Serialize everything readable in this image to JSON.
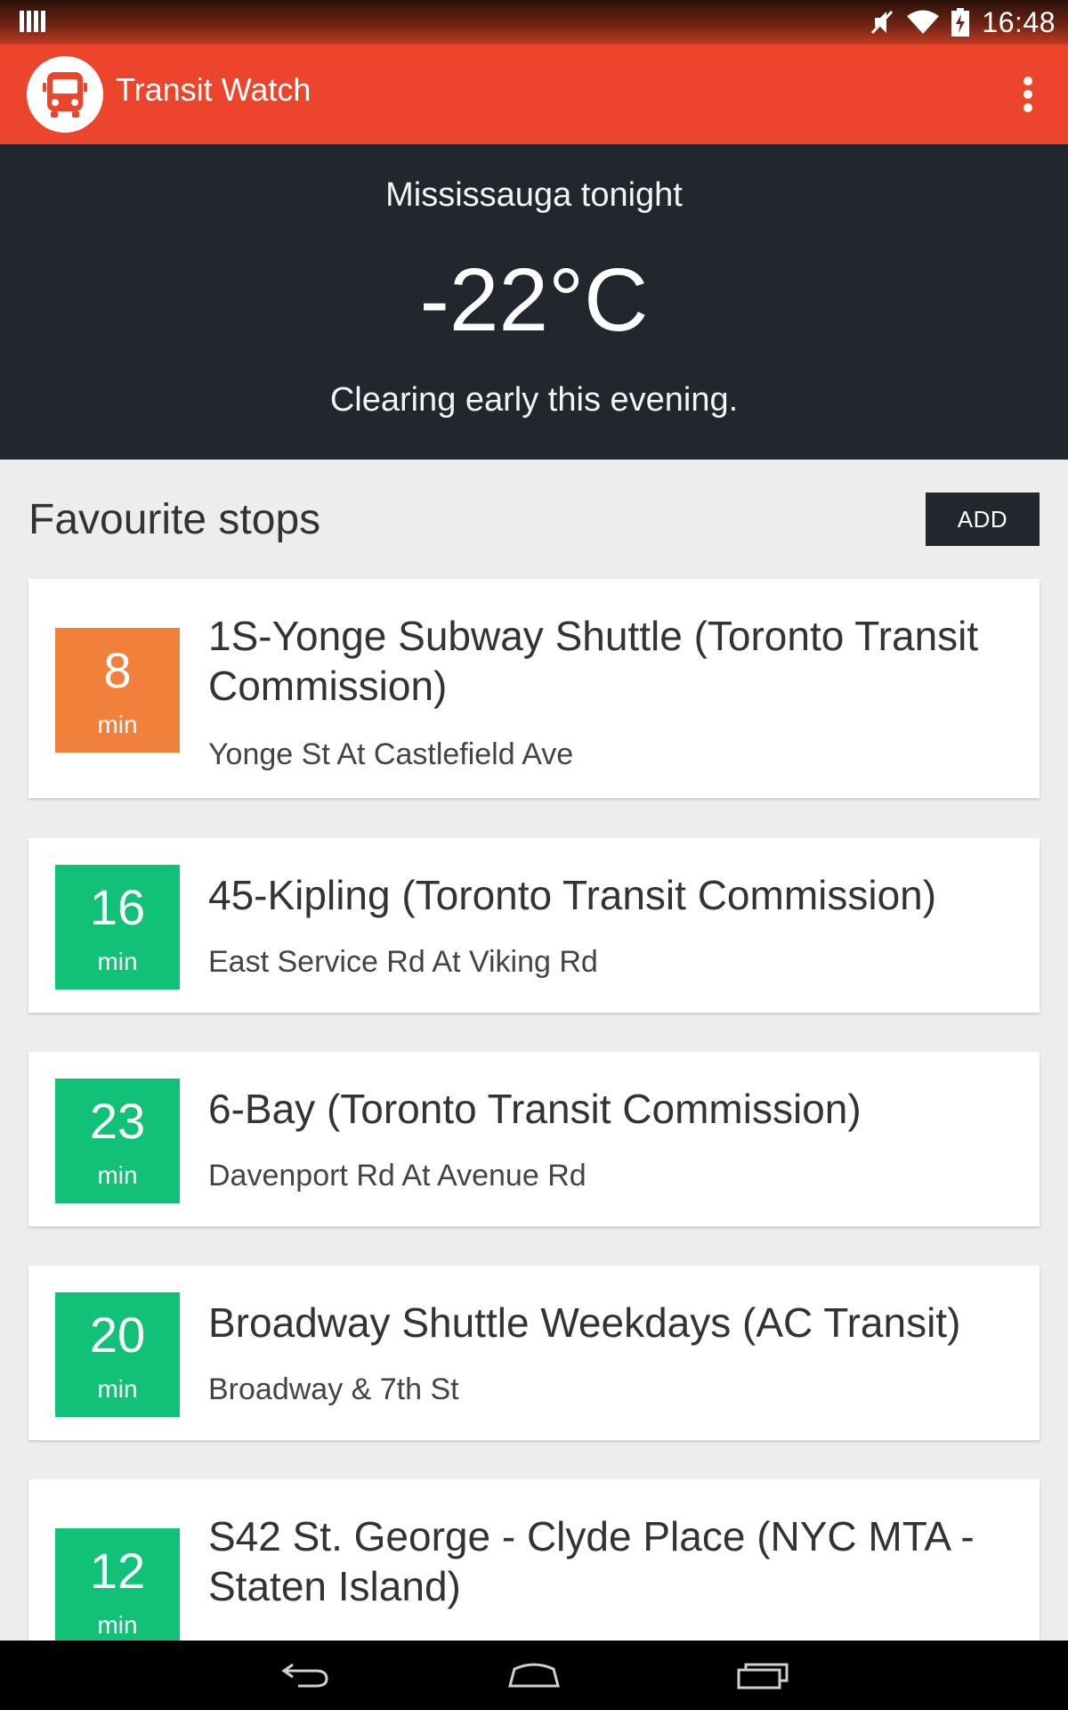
{
  "status_bar": {
    "time": "16:48",
    "icons": [
      "barcode-icon",
      "mute-icon",
      "wifi-icon",
      "battery-charging-icon"
    ]
  },
  "app_bar": {
    "title": "Transit Watch",
    "logo_icon": "bus-icon",
    "menu_icon": "more-vert-icon",
    "color": "#ec452c"
  },
  "weather": {
    "location": "Mississauga tonight",
    "temperature": "-22°C",
    "description": "Clearing early this evening."
  },
  "favourites": {
    "title": "Favourite stops",
    "add_label": "ADD",
    "stops": [
      {
        "eta": "8",
        "unit": "min",
        "route": "1S-Yonge Subway Shuttle (Toronto Transit Commission)",
        "stop": "Yonge St At Castlefield Ave",
        "color": "#f1803b"
      },
      {
        "eta": "16",
        "unit": "min",
        "route": "45-Kipling (Toronto Transit Commission)",
        "stop": "East Service Rd At Viking Rd",
        "color": "#12c178"
      },
      {
        "eta": "23",
        "unit": "min",
        "route": "6-Bay (Toronto Transit Commission)",
        "stop": "Davenport Rd At Avenue Rd",
        "color": "#12c178"
      },
      {
        "eta": "20",
        "unit": "min",
        "route": "Broadway Shuttle Weekdays (AC Transit)",
        "stop": "Broadway & 7th St",
        "color": "#12c178"
      },
      {
        "eta": "12",
        "unit": "min",
        "route": "S42 St. George - Clyde Place (NYC MTA - Staten Island)",
        "stop": "",
        "color": "#12c178"
      }
    ]
  },
  "nav_bar": {
    "icons": [
      "back-icon",
      "home-icon",
      "recents-icon"
    ]
  }
}
